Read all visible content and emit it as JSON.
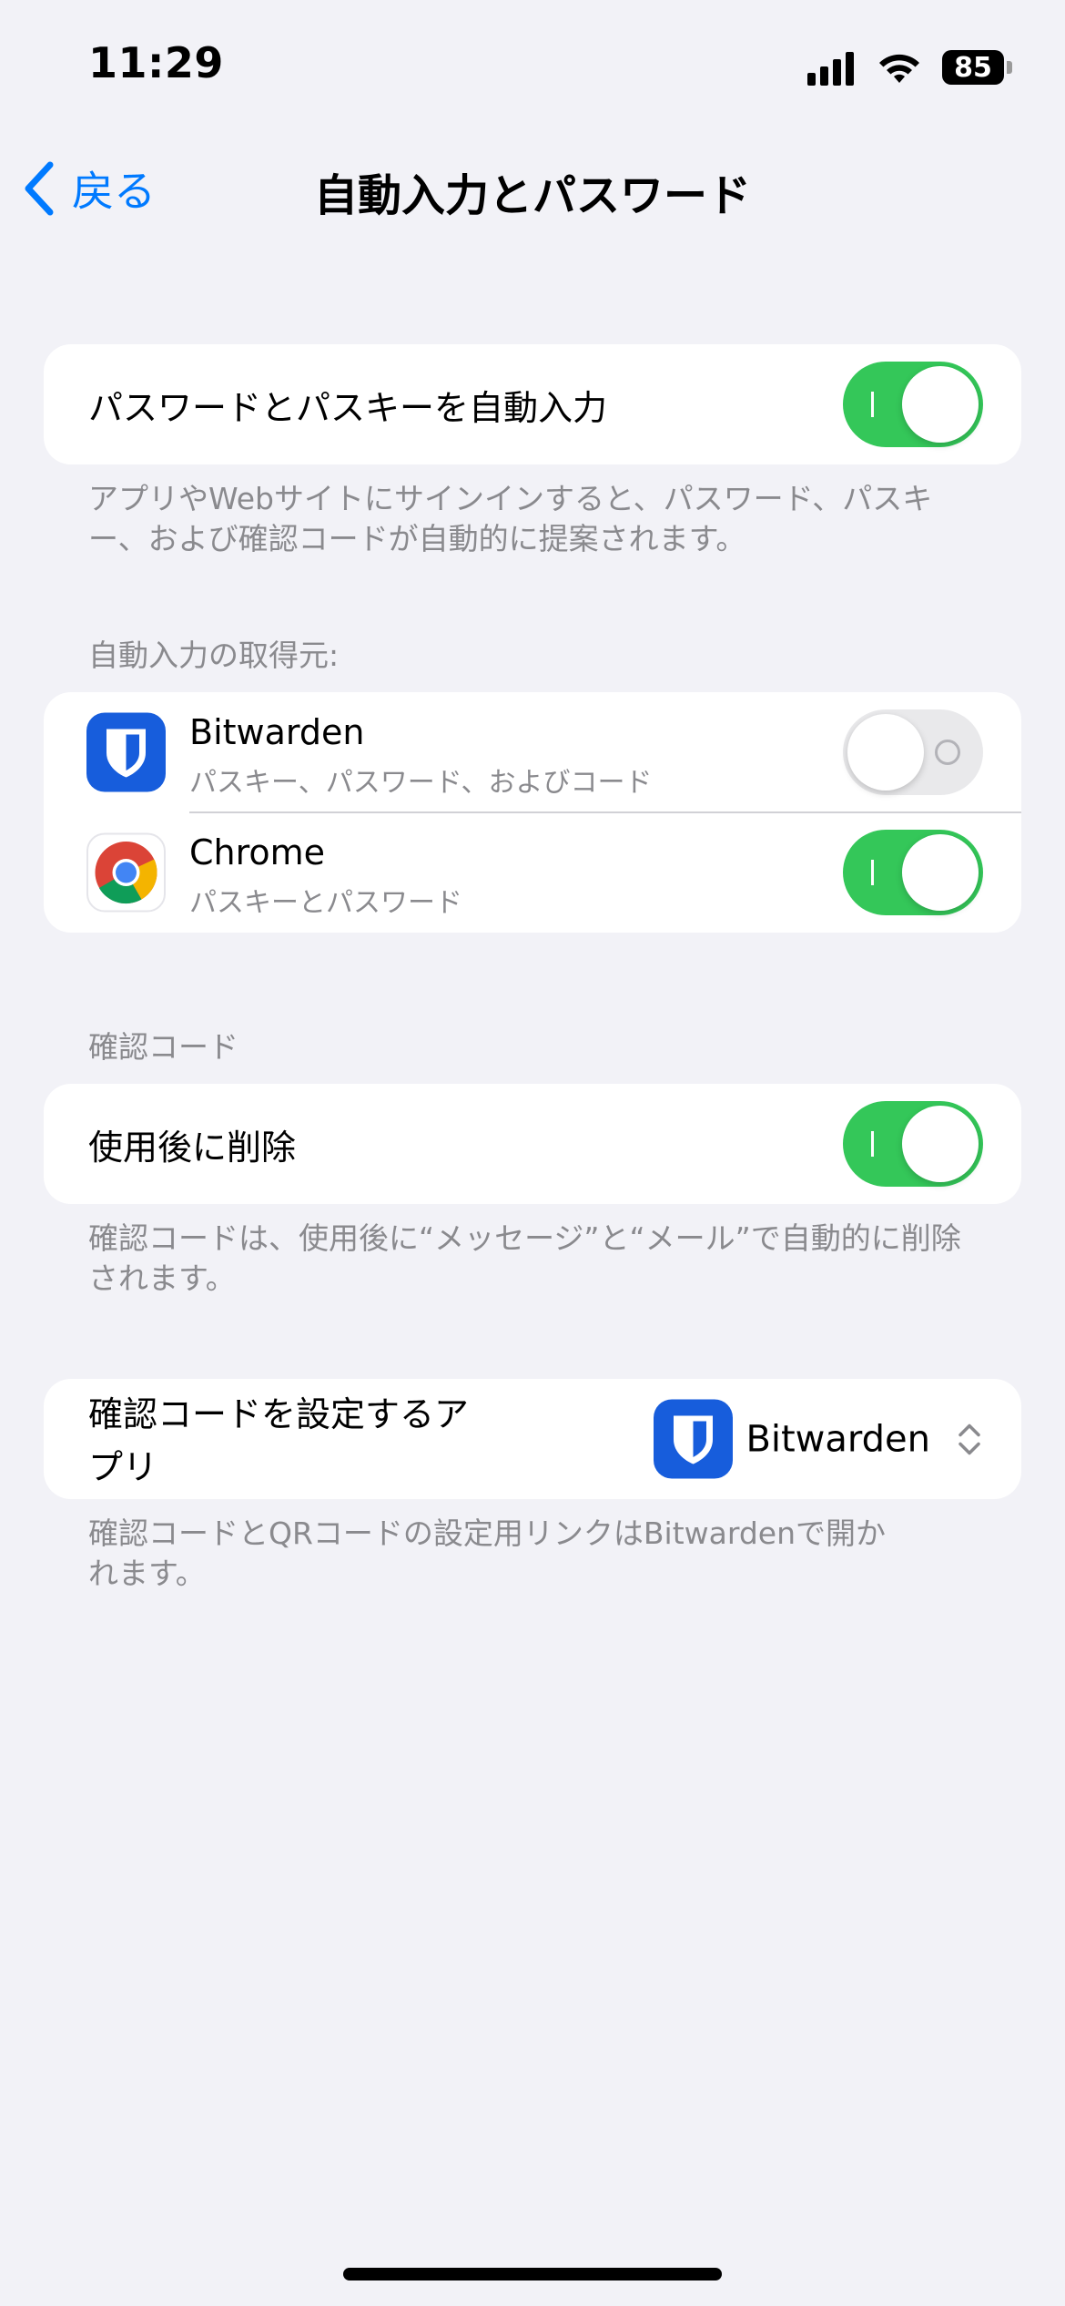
{
  "status_bar": {
    "time": "11:29",
    "battery": "85"
  },
  "nav": {
    "back_label": "戻る",
    "title": "自動入力とパスワード"
  },
  "autofill": {
    "label": "パスワードとパスキーを自動入力",
    "enabled": true,
    "footer": "アプリやWebサイトにサインインすると、パスワード、パスキー、および確認コードが自動的に提案されます。"
  },
  "sources": {
    "header": "自動入力の取得元:",
    "items": [
      {
        "name": "Bitwarden",
        "subtitle": "パスキー、パスワード、およびコード",
        "enabled": false,
        "icon": "bitwarden-icon"
      },
      {
        "name": "Chrome",
        "subtitle": "パスキーとパスワード",
        "enabled": true,
        "icon": "chrome-icon"
      }
    ]
  },
  "verification": {
    "header": "確認コード",
    "delete_label": "使用後に削除",
    "delete_enabled": true,
    "delete_footer": "確認コードは、使用後に“メッセージ”と“メール”で自動的に削除されます。"
  },
  "code_app": {
    "label": "確認コードを設定するアプリ",
    "value": "Bitwarden",
    "footer": "確認コードとQRコードの設定用リンクはBitwardenで開かれます。"
  },
  "colors": {
    "accent": "#007AFF",
    "toggle_on": "#34C759",
    "bitwarden": "#175DDC"
  }
}
